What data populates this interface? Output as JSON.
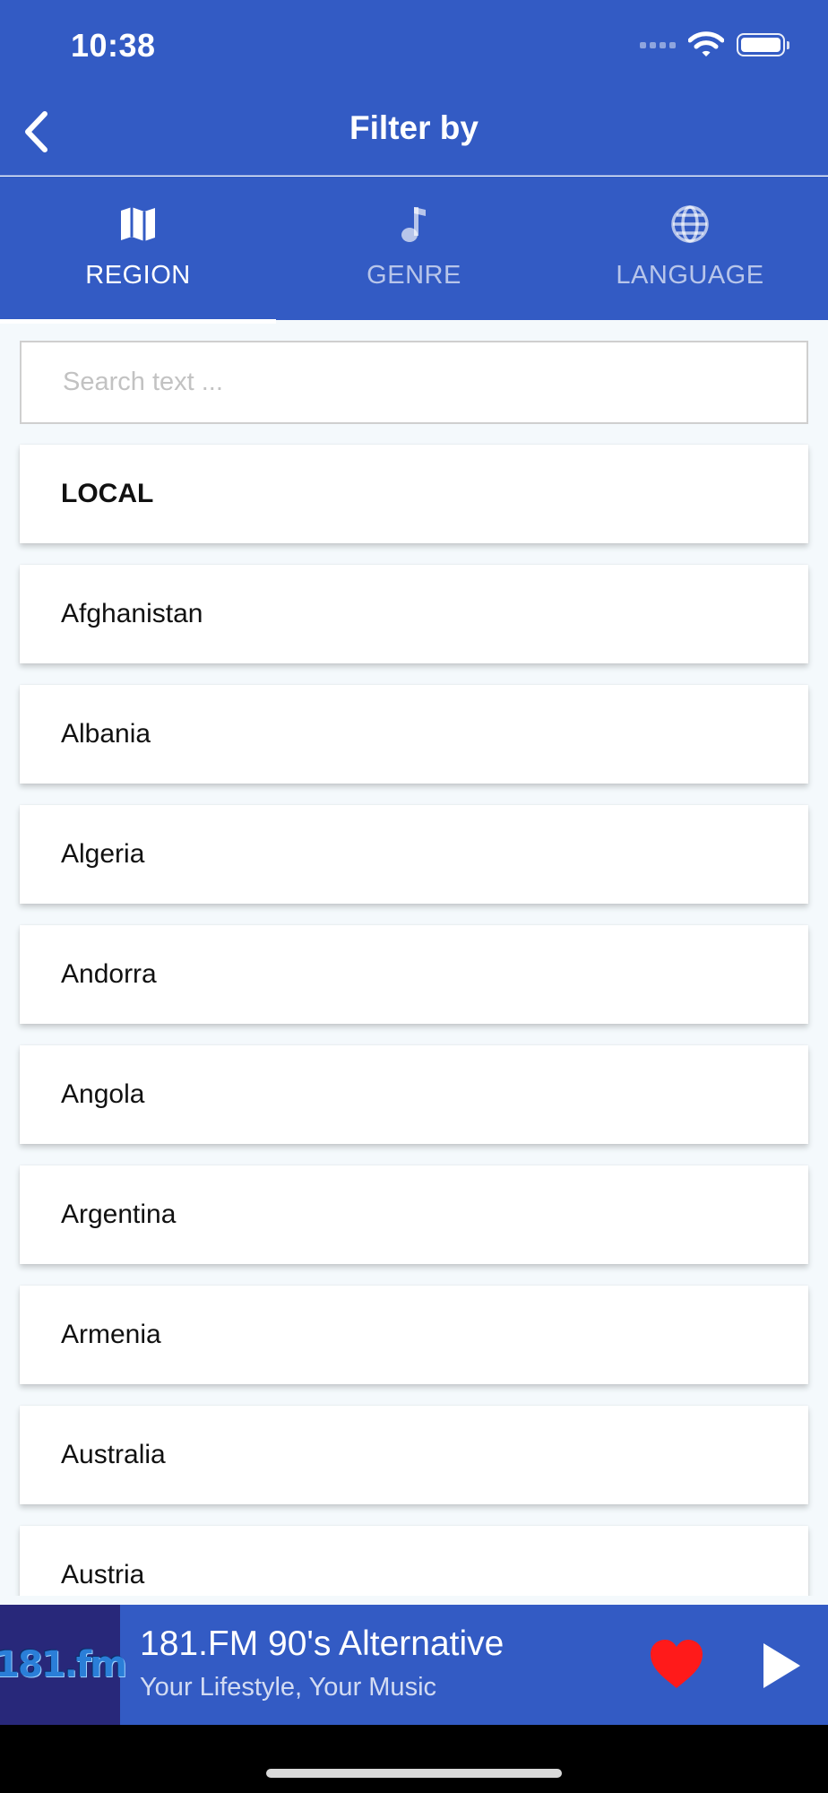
{
  "status_bar": {
    "time": "10:38"
  },
  "nav": {
    "title": "Filter by",
    "back_icon": "chevron-left-icon"
  },
  "tabs": [
    {
      "label": "REGION",
      "icon": "map-icon",
      "active": true
    },
    {
      "label": "GENRE",
      "icon": "music-note-icon",
      "active": false
    },
    {
      "label": "LANGUAGE",
      "icon": "globe-icon",
      "active": false
    }
  ],
  "search": {
    "placeholder": "Search text ...",
    "value": ""
  },
  "regions": [
    {
      "label": "LOCAL"
    },
    {
      "label": "Afghanistan"
    },
    {
      "label": "Albania"
    },
    {
      "label": "Algeria"
    },
    {
      "label": "Andorra"
    },
    {
      "label": "Angola"
    },
    {
      "label": "Argentina"
    },
    {
      "label": "Armenia"
    },
    {
      "label": "Australia"
    },
    {
      "label": "Austria"
    }
  ],
  "player": {
    "logo_text": "181.fm",
    "title": "181.FM 90's Alternative",
    "subtitle": "Your Lifestyle, Your Music",
    "favorite_icon": "heart-icon",
    "play_icon": "play-icon"
  },
  "colors": {
    "primary": "#335bc4",
    "background": "#f4f9fc",
    "favorite": "#ff1a1a",
    "logo_bg": "#28287a"
  }
}
